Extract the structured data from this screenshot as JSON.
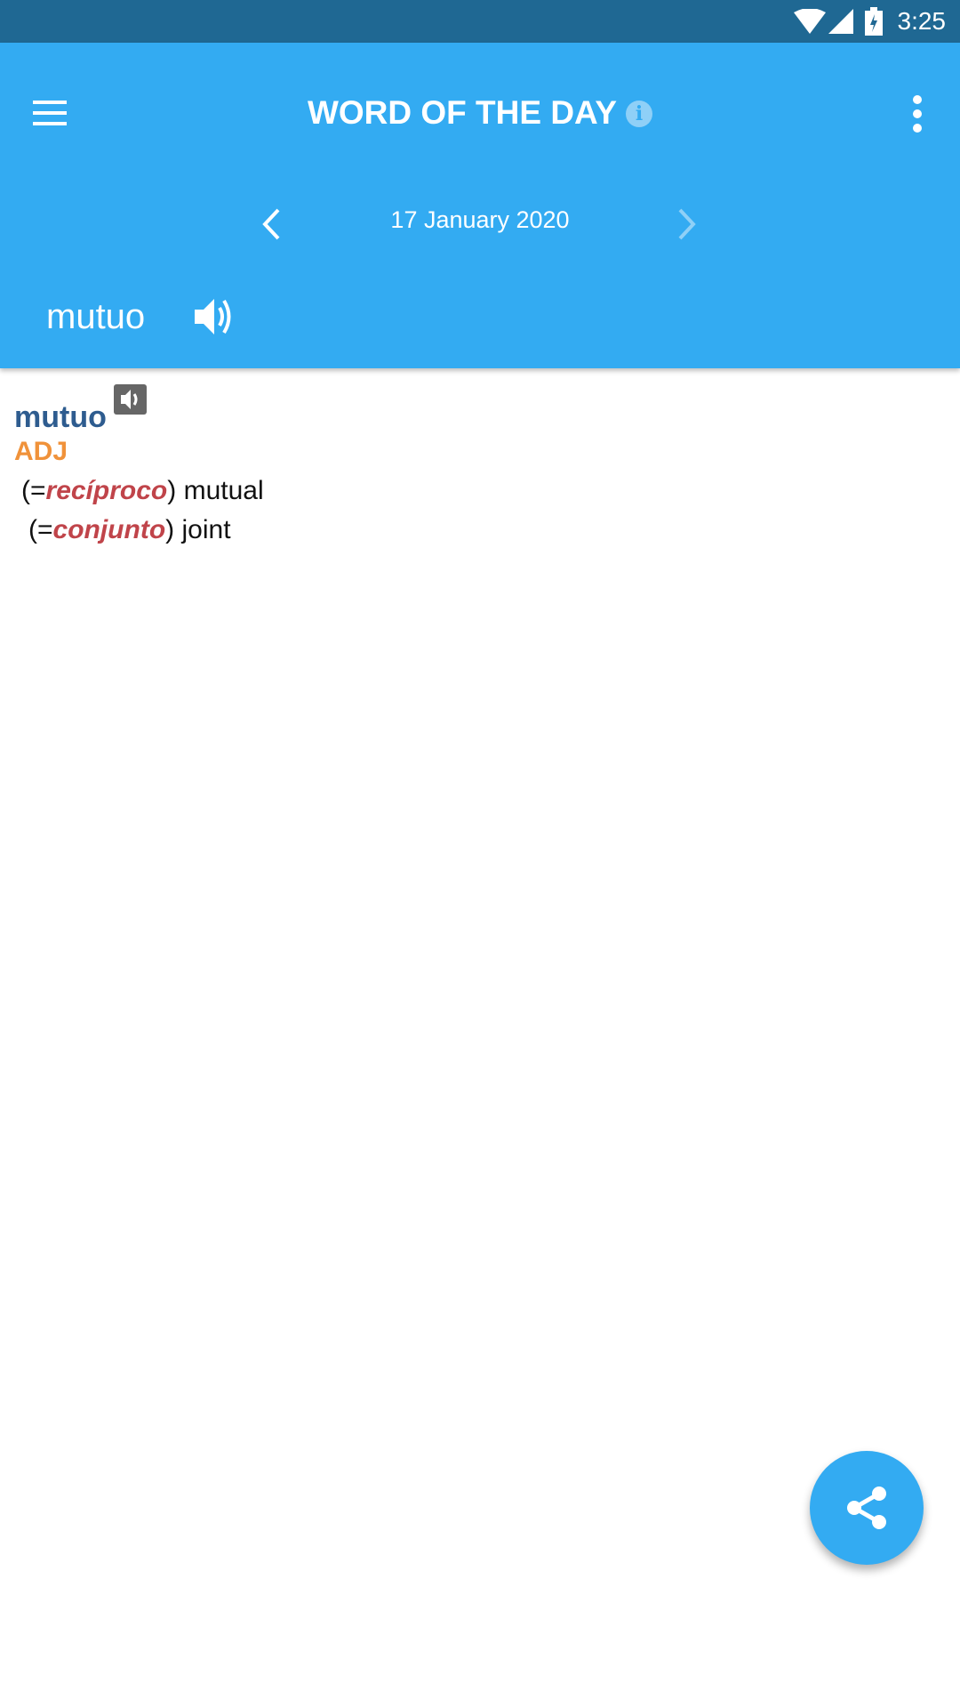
{
  "status_bar": {
    "time": "3:25"
  },
  "app_bar": {
    "title": "WORD OF THE DAY",
    "info_icon": "info-icon",
    "menu_icon": "hamburger-icon",
    "more_icon": "more-vert-icon"
  },
  "date_nav": {
    "date": "17 January 2020",
    "prev_icon": "chevron-left-icon",
    "next_icon": "chevron-right-icon"
  },
  "word_header": {
    "word": "mutuo",
    "audio_icon": "speaker-icon"
  },
  "entry": {
    "headword": "mutuo",
    "part_of_speech": "ADJ",
    "senses": [
      {
        "prefix": "(=",
        "reference": "recíproco",
        "suffix": ")",
        "translation": "mutual"
      },
      {
        "prefix": "(=",
        "reference": "conjunto",
        "suffix": ")",
        "translation": "joint"
      }
    ]
  },
  "fab": {
    "icon": "share-icon"
  },
  "colors": {
    "status_bar": "#1f6893",
    "app_bar": "#33abf2",
    "headword": "#2e5c8f",
    "pos": "#f0923a",
    "reference": "#c0444a"
  }
}
